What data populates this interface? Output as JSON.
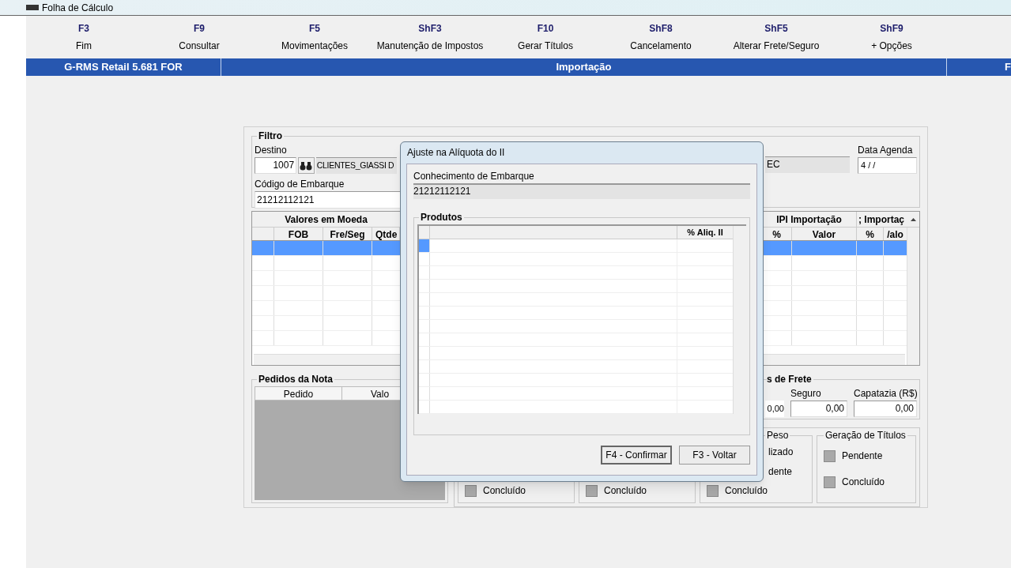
{
  "window": {
    "title": "Folha de Cálculo"
  },
  "toolbar": [
    {
      "key": "F3",
      "label": "Fim"
    },
    {
      "key": "F9",
      "label": "Consultar"
    },
    {
      "key": "F5",
      "label": "Movimentações"
    },
    {
      "key": "ShF3",
      "label": "Manutenção de Impostos"
    },
    {
      "key": "F10",
      "label": "Gerar Títulos"
    },
    {
      "key": "ShF8",
      "label": "Cancelamento"
    },
    {
      "key": "ShF5",
      "label": "Alterar Frete/Seguro"
    },
    {
      "key": "ShF9",
      "label": "+ Opções"
    }
  ],
  "header_bar": {
    "app": "G-RMS Retail 5.681 FOR",
    "screen": "Importação",
    "right_cut": "F"
  },
  "filter": {
    "legend": "Filtro",
    "destino_label": "Destino",
    "destino_code": "1007",
    "destino_name": "CLIENTES_GIASSI D",
    "embarque_label": "Código de Embarque",
    "embarque_value": "21212112121",
    "field_cut": "EC",
    "data_agenda_label": "Data Agenda",
    "data_agenda_value": "4 / /"
  },
  "values_grid": {
    "group_left": "Valores em Moeda",
    "group_ipi": "IPI Importação",
    "group_cut": "; Importaç",
    "columns_left": [
      "FOB",
      "Fre/Seg",
      "Qtde"
    ],
    "columns_right": [
      "%",
      "Valor",
      "%",
      "/alo"
    ],
    "rows": [
      {
        "selected": true
      },
      {
        "selected": false
      },
      {
        "selected": false
      },
      {
        "selected": false
      },
      {
        "selected": false
      },
      {
        "selected": false
      },
      {
        "selected": false
      }
    ]
  },
  "pedidos": {
    "legend": "Pedidos da Nota",
    "columns": [
      "Pedido",
      "Valo"
    ]
  },
  "frete": {
    "legend": "s de Frete",
    "cut_value": "0,00",
    "fields": [
      {
        "label": "Seguro",
        "value": "0,00"
      },
      {
        "label": "Capatazia (R$)",
        "value": "0,00"
      }
    ]
  },
  "status_groups": [
    {
      "items": [
        {
          "label": "Concluído",
          "checked": false
        }
      ]
    },
    {
      "items": [
        {
          "label": "Concluído",
          "checked": false
        }
      ]
    },
    {
      "legend": "Peso",
      "texts": [
        "lizado",
        "dente"
      ],
      "items": [
        {
          "label": "Concluído",
          "checked": false
        }
      ]
    },
    {
      "legend": "Geração de Títulos",
      "items": [
        {
          "label": "Pendente",
          "checked": false
        },
        {
          "label": "Concluído",
          "checked": false
        }
      ]
    }
  ],
  "dialog": {
    "title": "Ajuste na Alíquota do II",
    "conhecimento_label": "Conhecimento de Embarque",
    "conhecimento_value": "21212112121",
    "produtos_legend": "Produtos",
    "column": "% Aliq. II",
    "rows": [
      {
        "selected": true
      },
      {
        "selected": false
      },
      {
        "selected": false
      },
      {
        "selected": false
      },
      {
        "selected": false
      },
      {
        "selected": false
      },
      {
        "selected": false
      },
      {
        "selected": false
      },
      {
        "selected": false
      },
      {
        "selected": false
      },
      {
        "selected": false
      },
      {
        "selected": false
      },
      {
        "selected": false
      }
    ],
    "buttons": [
      {
        "label": "F4 - Confirmar",
        "focused": true
      },
      {
        "label": "F3 - Voltar",
        "focused": false
      }
    ]
  }
}
